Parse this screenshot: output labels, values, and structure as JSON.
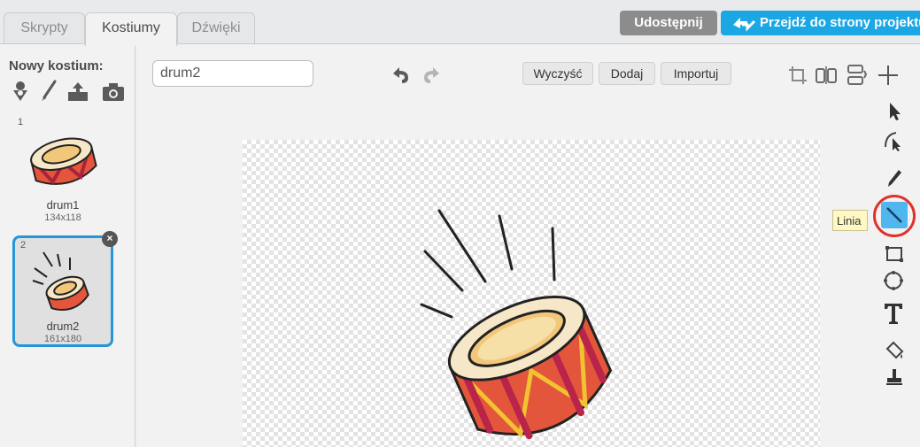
{
  "tabs": [
    {
      "label": "Skrypty"
    },
    {
      "label": "Kostiumy"
    },
    {
      "label": "Dźwięki"
    }
  ],
  "header": {
    "share_label": "Udostępnij",
    "project_page_label": "Przejdź do strony projektu"
  },
  "costume_panel": {
    "new_costume_label": "Nowy kostium:",
    "costumes": [
      {
        "number": "1",
        "name": "drum1",
        "size": "134x118"
      },
      {
        "number": "2",
        "name": "drum2",
        "size": "161x180"
      }
    ]
  },
  "editor": {
    "costume_name_value": "drum2",
    "clear_label": "Wyczyść",
    "add_label": "Dodaj",
    "import_label": "Importuj",
    "tooltip_label": "Linia"
  },
  "colors": {
    "accent_blue": "#1aa7e4",
    "selected_border": "#2696d8",
    "highlight_red": "#e0302a",
    "share_gray": "#8c8c8c"
  }
}
